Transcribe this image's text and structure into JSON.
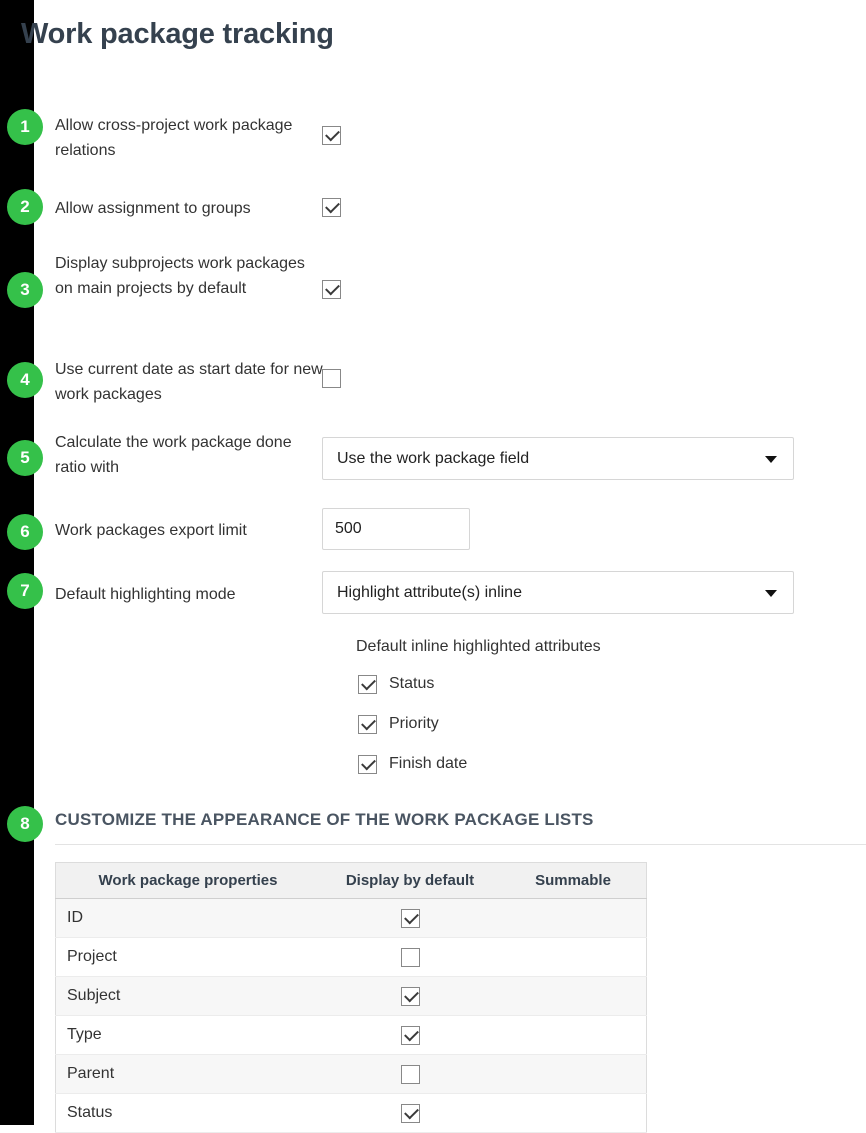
{
  "page": {
    "title": "Work package tracking"
  },
  "badges": [
    "1",
    "2",
    "3",
    "4",
    "5",
    "6",
    "7",
    "8"
  ],
  "settings": [
    {
      "badge": "1",
      "label": "Allow cross-project work package relations",
      "control": "checkbox",
      "checked": true
    },
    {
      "badge": "2",
      "label": "Allow assignment to groups",
      "control": "checkbox",
      "checked": true
    },
    {
      "badge": "3",
      "label": "Display subprojects work packages on main projects by default",
      "control": "checkbox",
      "checked": true
    },
    {
      "badge": "4",
      "label": "Use current date as start date for new work packages",
      "control": "checkbox",
      "checked": false
    },
    {
      "badge": "5",
      "label": "Calculate the work package done ratio with",
      "control": "select",
      "value": "Use the work package field"
    },
    {
      "badge": "6",
      "label": "Work packages export limit",
      "control": "text",
      "value": "500"
    },
    {
      "badge": "7",
      "label": "Default highlighting mode",
      "control": "select",
      "value": "Highlight attribute(s) inline"
    }
  ],
  "inline_attributes": {
    "title": "Default inline highlighted attributes",
    "items": [
      {
        "label": "Status",
        "checked": true
      },
      {
        "label": "Priority",
        "checked": true
      },
      {
        "label": "Finish date",
        "checked": true
      }
    ]
  },
  "appearance_section": {
    "badge": "8",
    "heading": "CUSTOMIZE THE APPEARANCE OF THE WORK PACKAGE LISTS",
    "table": {
      "columns": [
        "Work package properties",
        "Display by default",
        "Summable"
      ],
      "rows": [
        {
          "name": "ID",
          "display_by_default": true,
          "summable": null
        },
        {
          "name": "Project",
          "display_by_default": false,
          "summable": null
        },
        {
          "name": "Subject",
          "display_by_default": true,
          "summable": null
        },
        {
          "name": "Type",
          "display_by_default": true,
          "summable": null
        },
        {
          "name": "Parent",
          "display_by_default": false,
          "summable": null
        },
        {
          "name": "Status",
          "display_by_default": true,
          "summable": null
        }
      ]
    }
  },
  "colors": {
    "badge_green": "#35c14a",
    "rail_black": "#000000",
    "title_ink": "#35414e",
    "heading_ink": "#4a5562"
  },
  "icons": {
    "dropdown": "chevron-down-icon",
    "checkmark": "check-icon"
  }
}
